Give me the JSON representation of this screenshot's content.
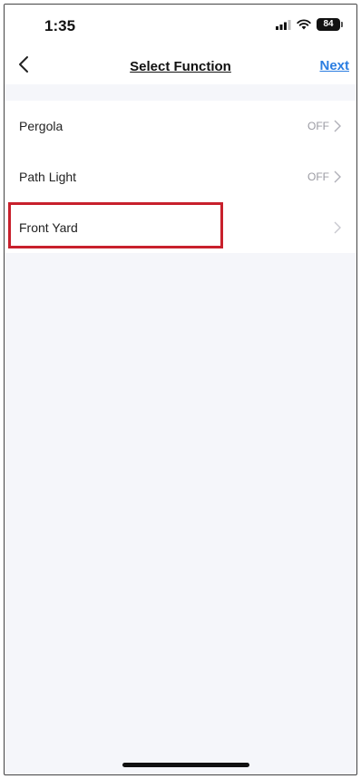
{
  "status_bar": {
    "time": "1:35",
    "battery": "84",
    "icons": [
      "signal-icon",
      "wifi-icon",
      "battery-icon"
    ]
  },
  "nav": {
    "title": "Select Function",
    "next_label": "Next",
    "back_icon": "chevron-left-icon"
  },
  "functions": [
    {
      "label": "Pergola",
      "status": "OFF"
    },
    {
      "label": "Path Light",
      "status": "OFF"
    },
    {
      "label": "Front Yard",
      "status": ""
    }
  ],
  "colors": {
    "accent": "#2a7de1",
    "highlight": "#c8202c",
    "background": "#f5f6fa"
  }
}
